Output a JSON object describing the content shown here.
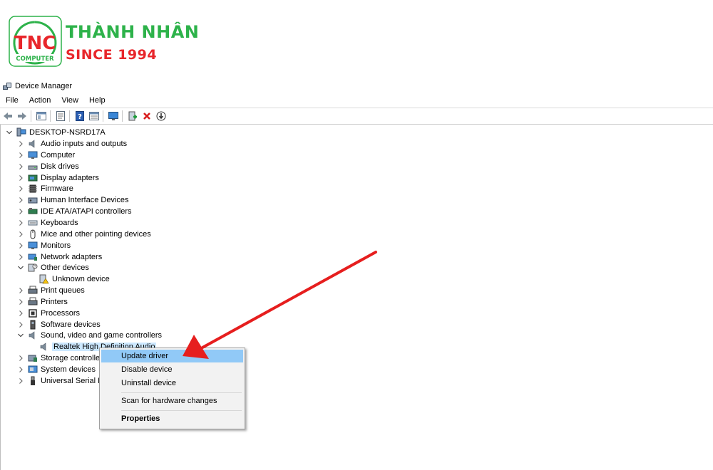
{
  "logo": {
    "mark_text": "TNC",
    "computer_text": "COMPUTER",
    "brand_name": "THÀNH NHÂN",
    "since": "SINCE 1994",
    "brand_color": "#e8262b",
    "green": "#2db24a"
  },
  "window": {
    "title": "Device Manager"
  },
  "menu": [
    "File",
    "Action",
    "View",
    "Help"
  ],
  "toolbar_icons": [
    "back-icon",
    "forward-icon",
    "properties-view-icon",
    "properties-icon",
    "help-icon",
    "details-view-icon",
    "monitor-scan-icon",
    "add-driver-icon",
    "uninstall-x-icon",
    "download-driver-icon"
  ],
  "tree": {
    "root": "DESKTOP-NSRD17A",
    "items": [
      {
        "label": "Audio inputs and outputs",
        "icon": "speaker-icon",
        "state": "collapsed"
      },
      {
        "label": "Computer",
        "icon": "computer-icon",
        "state": "collapsed"
      },
      {
        "label": "Disk drives",
        "icon": "disk-icon",
        "state": "collapsed"
      },
      {
        "label": "Display adapters",
        "icon": "display-adapter-icon",
        "state": "collapsed"
      },
      {
        "label": "Firmware",
        "icon": "chip-icon",
        "state": "collapsed"
      },
      {
        "label": "Human Interface Devices",
        "icon": "hid-icon",
        "state": "collapsed"
      },
      {
        "label": "IDE ATA/ATAPI controllers",
        "icon": "ide-icon",
        "state": "collapsed"
      },
      {
        "label": "Keyboards",
        "icon": "keyboard-icon",
        "state": "collapsed"
      },
      {
        "label": "Mice and other pointing devices",
        "icon": "mouse-icon",
        "state": "collapsed"
      },
      {
        "label": "Monitors",
        "icon": "monitor-icon",
        "state": "collapsed"
      },
      {
        "label": "Network adapters",
        "icon": "network-icon",
        "state": "collapsed"
      },
      {
        "label": "Other devices",
        "icon": "unknown-device-icon",
        "state": "expanded"
      },
      {
        "label": "Unknown device",
        "icon": "warning-device-icon",
        "child": true
      },
      {
        "label": "Print queues",
        "icon": "printer-icon",
        "state": "collapsed"
      },
      {
        "label": "Printers",
        "icon": "printer-icon",
        "state": "collapsed"
      },
      {
        "label": "Processors",
        "icon": "processor-icon",
        "state": "collapsed"
      },
      {
        "label": "Software devices",
        "icon": "software-device-icon",
        "state": "collapsed"
      },
      {
        "label": "Sound, video and game controllers",
        "icon": "speaker-icon",
        "state": "expanded"
      },
      {
        "label": "Realtek High Definition Audio",
        "icon": "speaker-icon",
        "child": true,
        "selected": true
      },
      {
        "label": "Storage controller",
        "icon": "storage-icon",
        "state": "collapsed"
      },
      {
        "label": "System devices",
        "icon": "system-icon",
        "state": "collapsed"
      },
      {
        "label": "Universal Serial Bu",
        "icon": "usb-icon",
        "state": "collapsed"
      }
    ]
  },
  "context_menu": {
    "items": [
      "Update driver",
      "Disable device",
      "Uninstall device",
      "Scan for hardware changes",
      "Properties"
    ],
    "highlighted": "Update driver"
  },
  "annotation": {
    "arrow_color": "#e61e1e"
  }
}
